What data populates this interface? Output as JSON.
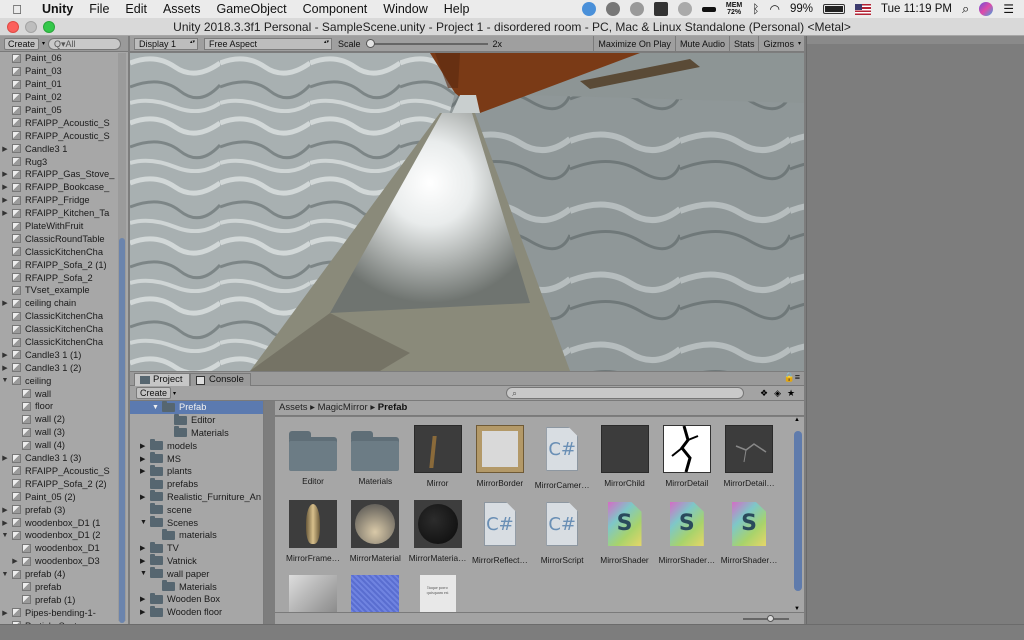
{
  "menubar": {
    "app_name": "Unity",
    "items": [
      "File",
      "Edit",
      "Assets",
      "GameObject",
      "Component",
      "Window",
      "Help"
    ],
    "memory_label": "MEM",
    "memory_value": "72%",
    "battery_percent": "99%",
    "battery_level": 0.99,
    "clock": "Tue 11:19 PM"
  },
  "window": {
    "title": "Unity 2018.3.3f1 Personal - SampleScene.unity - Project 1 - disordered room - PC, Mac & Linux Standalone (Personal) <Metal>"
  },
  "hierarchy": {
    "create_label": "Create",
    "search_placeholder": "Q▾All",
    "rows": [
      {
        "label": "Paint_06",
        "indent": 1,
        "arrow": ""
      },
      {
        "label": "Paint_03",
        "indent": 1,
        "arrow": ""
      },
      {
        "label": "Paint_01",
        "indent": 1,
        "arrow": ""
      },
      {
        "label": "Paint_02",
        "indent": 1,
        "arrow": ""
      },
      {
        "label": "Paint_05",
        "indent": 1,
        "arrow": ""
      },
      {
        "label": "RFAIPP_Acoustic_S",
        "indent": 1,
        "arrow": ""
      },
      {
        "label": "RFAIPP_Acoustic_S",
        "indent": 1,
        "arrow": ""
      },
      {
        "label": "Candle3 1",
        "indent": 1,
        "arrow": "▶"
      },
      {
        "label": "Rug3",
        "indent": 1,
        "arrow": ""
      },
      {
        "label": "RFAIPP_Gas_Stove_",
        "indent": 1,
        "arrow": "▶"
      },
      {
        "label": "RFAIPP_Bookcase_",
        "indent": 1,
        "arrow": "▶"
      },
      {
        "label": "RFAIPP_Fridge",
        "indent": 1,
        "arrow": "▶"
      },
      {
        "label": "RFAIPP_Kitchen_Ta",
        "indent": 1,
        "arrow": "▶"
      },
      {
        "label": "PlateWithFruit",
        "indent": 1,
        "arrow": ""
      },
      {
        "label": "ClassicRoundTable",
        "indent": 1,
        "arrow": ""
      },
      {
        "label": "ClassicKitchenCha",
        "indent": 1,
        "arrow": ""
      },
      {
        "label": "RFAIPP_Sofa_2 (1)",
        "indent": 1,
        "arrow": ""
      },
      {
        "label": "RFAIPP_Sofa_2",
        "indent": 1,
        "arrow": ""
      },
      {
        "label": "TVset_example",
        "indent": 1,
        "arrow": ""
      },
      {
        "label": "ceiling chain",
        "indent": 1,
        "arrow": "▶"
      },
      {
        "label": "ClassicKitchenCha",
        "indent": 1,
        "arrow": ""
      },
      {
        "label": "ClassicKitchenCha",
        "indent": 1,
        "arrow": ""
      },
      {
        "label": "ClassicKitchenCha",
        "indent": 1,
        "arrow": ""
      },
      {
        "label": "Candle3 1 (1)",
        "indent": 1,
        "arrow": "▶"
      },
      {
        "label": "Candle3 1 (2)",
        "indent": 1,
        "arrow": "▶"
      },
      {
        "label": "ceiling",
        "indent": 1,
        "arrow": "▼"
      },
      {
        "label": "wall",
        "indent": 2,
        "arrow": ""
      },
      {
        "label": "floor",
        "indent": 2,
        "arrow": ""
      },
      {
        "label": "wall (2)",
        "indent": 2,
        "arrow": ""
      },
      {
        "label": "wall (3)",
        "indent": 2,
        "arrow": ""
      },
      {
        "label": "wall (4)",
        "indent": 2,
        "arrow": ""
      },
      {
        "label": "Candle3 1 (3)",
        "indent": 1,
        "arrow": "▶"
      },
      {
        "label": "RFAIPP_Acoustic_S",
        "indent": 1,
        "arrow": ""
      },
      {
        "label": "RFAIPP_Sofa_2 (2)",
        "indent": 1,
        "arrow": ""
      },
      {
        "label": "Paint_05 (2)",
        "indent": 1,
        "arrow": ""
      },
      {
        "label": "prefab (3)",
        "indent": 1,
        "arrow": "▶"
      },
      {
        "label": "woodenbox_D1 (1",
        "indent": 1,
        "arrow": "▶"
      },
      {
        "label": "woodenbox_D1 (2",
        "indent": 1,
        "arrow": "▼"
      },
      {
        "label": "woodenbox_D1",
        "indent": 2,
        "arrow": ""
      },
      {
        "label": "woodenbox_D3",
        "indent": 2,
        "arrow": "▶"
      },
      {
        "label": "prefab (4)",
        "indent": 1,
        "arrow": "▼"
      },
      {
        "label": "prefab",
        "indent": 2,
        "arrow": ""
      },
      {
        "label": "prefab (1)",
        "indent": 2,
        "arrow": ""
      },
      {
        "label": "Pipes-bending-1-",
        "indent": 1,
        "arrow": "▶"
      },
      {
        "label": "Particle System",
        "indent": 1,
        "arrow": ""
      }
    ]
  },
  "game_toolbar": {
    "display": "Display 1",
    "aspect": "Free Aspect",
    "scale_label": "Scale",
    "scale_value": "2x",
    "scale_fraction": 0.0,
    "buttons": [
      "Maximize On Play",
      "Mute Audio",
      "Stats",
      "Gizmos"
    ]
  },
  "project": {
    "tabs": [
      {
        "label": "Project",
        "active": true
      },
      {
        "label": "Console",
        "active": false
      }
    ],
    "create_label": "Create",
    "breadcrumb": [
      "Assets",
      "MagicMirror",
      "Prefab"
    ],
    "tree": [
      {
        "label": "Prefab",
        "indent": 2,
        "arrow": "▼",
        "selected": true
      },
      {
        "label": "Editor",
        "indent": 3,
        "arrow": "",
        "selected": false
      },
      {
        "label": "Materials",
        "indent": 3,
        "arrow": "",
        "selected": false
      },
      {
        "label": "models",
        "indent": 1,
        "arrow": "▶",
        "selected": false
      },
      {
        "label": "MS",
        "indent": 1,
        "arrow": "▶",
        "selected": false
      },
      {
        "label": "plants",
        "indent": 1,
        "arrow": "▶",
        "selected": false
      },
      {
        "label": "prefabs",
        "indent": 1,
        "arrow": "",
        "selected": false
      },
      {
        "label": "Realistic_Furniture_An",
        "indent": 1,
        "arrow": "▶",
        "selected": false
      },
      {
        "label": "scene",
        "indent": 1,
        "arrow": "",
        "selected": false
      },
      {
        "label": "Scenes",
        "indent": 1,
        "arrow": "▼",
        "selected": false
      },
      {
        "label": "materials",
        "indent": 2,
        "arrow": "",
        "selected": false
      },
      {
        "label": "TV",
        "indent": 1,
        "arrow": "▶",
        "selected": false
      },
      {
        "label": "Vatnick",
        "indent": 1,
        "arrow": "▶",
        "selected": false
      },
      {
        "label": "wall paper",
        "indent": 1,
        "arrow": "▼",
        "selected": false
      },
      {
        "label": "Materials",
        "indent": 2,
        "arrow": "",
        "selected": false
      },
      {
        "label": "Wooden Box",
        "indent": 1,
        "arrow": "▶",
        "selected": false
      },
      {
        "label": "Wooden floor",
        "indent": 1,
        "arrow": "▶",
        "selected": false
      }
    ],
    "assets": [
      {
        "label": "Editor",
        "kind": "folder"
      },
      {
        "label": "Materials",
        "kind": "folder"
      },
      {
        "label": "Mirror",
        "kind": "mirror"
      },
      {
        "label": "MirrorBorder",
        "kind": "frame"
      },
      {
        "label": "MirrorCamer…",
        "kind": "script"
      },
      {
        "label": "MirrorChild",
        "kind": "dark"
      },
      {
        "label": "MirrorDetail",
        "kind": "crack"
      },
      {
        "label": "MirrorDetail…",
        "kind": "crackdark"
      },
      {
        "label": "MirrorFrame…",
        "kind": "vase"
      },
      {
        "label": "MirrorMaterial",
        "kind": "cone"
      },
      {
        "label": "MirrorMateria…",
        "kind": "ball"
      },
      {
        "label": "MirrorReflect…",
        "kind": "script"
      },
      {
        "label": "MirrorScript",
        "kind": "script"
      },
      {
        "label": "MirrorShader",
        "kind": "shader"
      },
      {
        "label": "MirrorShader…",
        "kind": "shader"
      },
      {
        "label": "MirrorShader…",
        "kind": "shader"
      },
      {
        "label": "",
        "kind": "grey"
      },
      {
        "label": "",
        "kind": "blue"
      },
      {
        "label": "",
        "kind": "paper"
      }
    ],
    "paper_text": "Itaque porro quisquam est",
    "script_glyph": "C#",
    "shader_glyph": "S"
  }
}
